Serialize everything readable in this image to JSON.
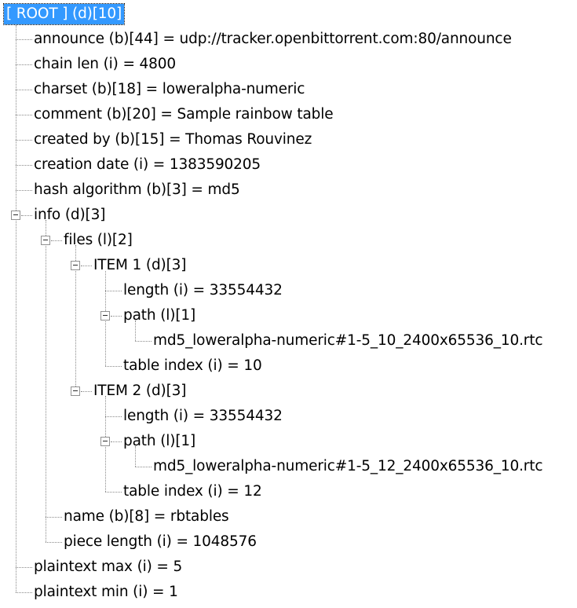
{
  "tree": {
    "root": "[ ROOT ] (d)[10]",
    "announce": "announce (b)[44] = udp://tracker.openbittorrent.com:80/announce",
    "chain_len": "chain len (i) = 4800",
    "charset": "charset (b)[18] = loweralpha-numeric",
    "comment": "comment (b)[20] = Sample rainbow table",
    "created_by": "created by (b)[15] = Thomas Rouvinez",
    "creation_date": "creation date (i) = 1383590205",
    "hash_algorithm": "hash algorithm (b)[3] = md5",
    "info": "info (d)[3]",
    "files": "files (l)[2]",
    "item1": "ITEM 1 (d)[3]",
    "item1_length": "length (i) = 33554432",
    "item1_path": "path (l)[1]",
    "item1_path_value": "md5_loweralpha-numeric#1-5_10_2400x65536_10.rtc",
    "item1_table_index": "table index (i) = 10",
    "item2": "ITEM 2 (d)[3]",
    "item2_length": "length (i) = 33554432",
    "item2_path": "path (l)[1]",
    "item2_path_value": "md5_loweralpha-numeric#1-5_12_2400x65536_10.rtc",
    "item2_table_index": "table index (i) = 12",
    "name": "name (b)[8] = rbtables",
    "piece_length": "piece length (i) = 1048576",
    "plaintext_max": "plaintext max (i) = 5",
    "plaintext_min": "plaintext min (i) = 1"
  }
}
